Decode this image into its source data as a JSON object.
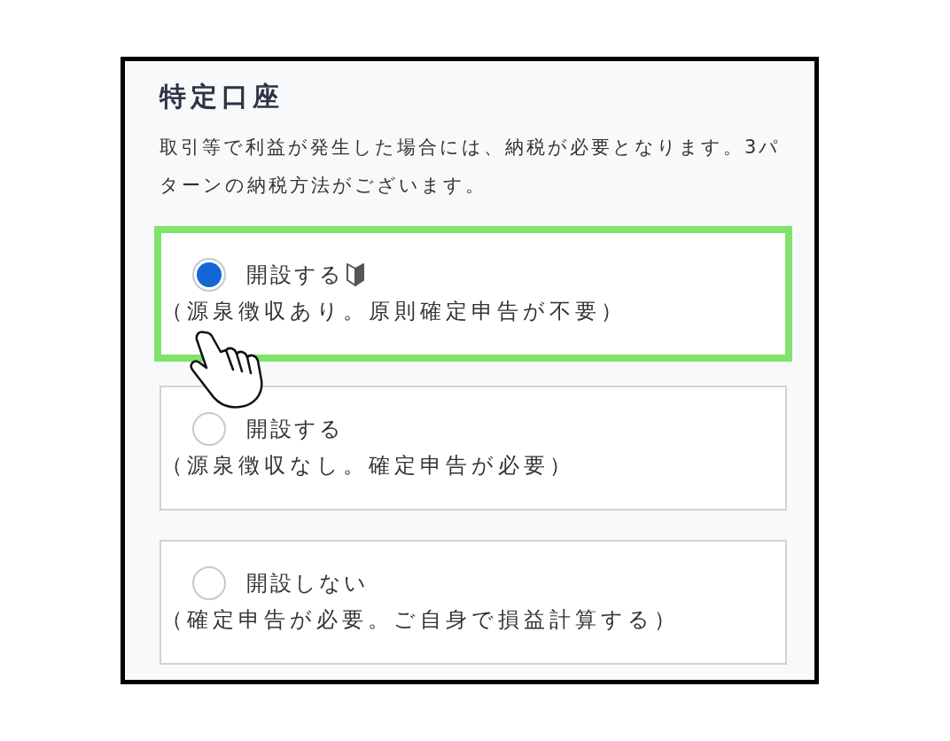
{
  "section": {
    "title": "特定口座",
    "description": "取引等で利益が発生した場合には、納税が必要となります。3パターンの納税方法がございます。"
  },
  "options": [
    {
      "label": "開設する",
      "note": "（源泉徴収あり。原則確定申告が不要）",
      "selected": true,
      "highlighted": true,
      "recommended": true
    },
    {
      "label": "開設する",
      "note": "（源泉徴収なし。確定申告が必要）",
      "selected": false,
      "highlighted": false,
      "recommended": false
    },
    {
      "label": "開設しない",
      "note": "（確定申告が必要。ご自身で損益計算する）",
      "selected": false,
      "highlighted": false,
      "recommended": false
    }
  ]
}
